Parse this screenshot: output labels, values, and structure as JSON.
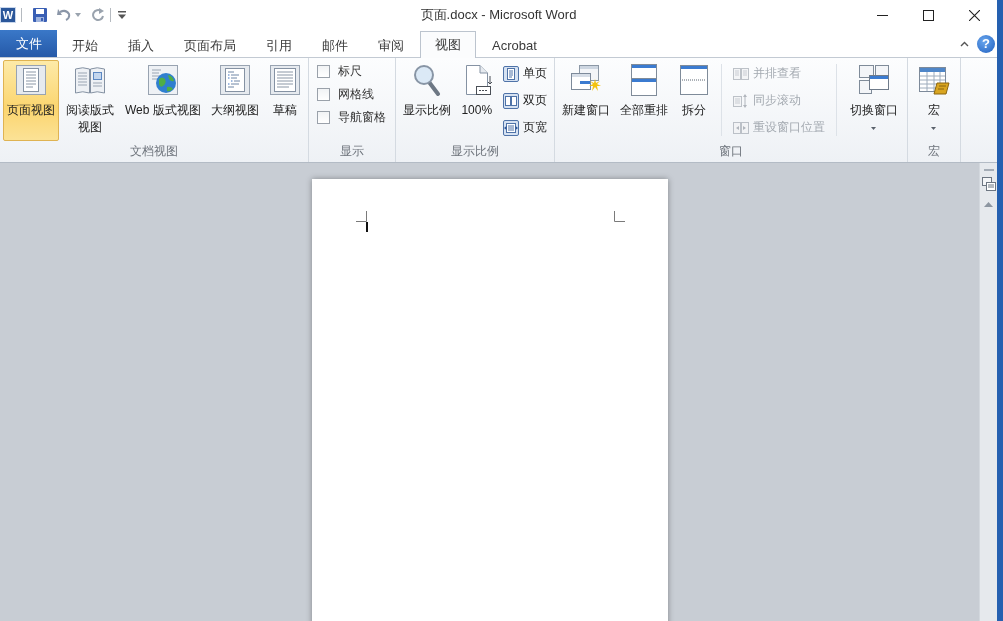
{
  "title_bar": {
    "app_icon": "W",
    "title": "页面.docx - Microsoft Word"
  },
  "tabs": [
    {
      "label": "文件",
      "kind": "file",
      "selected": false
    },
    {
      "label": "开始",
      "kind": "tab",
      "selected": false
    },
    {
      "label": "插入",
      "kind": "tab",
      "selected": false
    },
    {
      "label": "页面布局",
      "kind": "tab",
      "selected": false
    },
    {
      "label": "引用",
      "kind": "tab",
      "selected": false
    },
    {
      "label": "邮件",
      "kind": "tab",
      "selected": false
    },
    {
      "label": "审阅",
      "kind": "tab",
      "selected": false
    },
    {
      "label": "视图",
      "kind": "tab",
      "selected": true
    },
    {
      "label": "Acrobat",
      "kind": "tab",
      "selected": false
    }
  ],
  "help": {
    "label": "?"
  },
  "ribbon": [
    {
      "label": "文档视图",
      "items": [
        {
          "kind": "large",
          "label": "页面视图",
          "selected": true
        },
        {
          "kind": "large",
          "label": "阅读版式视图",
          "selected": false
        },
        {
          "kind": "large",
          "label": "Web 版式视图",
          "selected": false
        },
        {
          "kind": "large",
          "label": "大纲视图",
          "selected": false
        },
        {
          "kind": "large",
          "label": "草稿",
          "selected": false
        }
      ]
    },
    {
      "label": "显示",
      "items": [
        {
          "kind": "checkbox",
          "label": "标尺",
          "checked": false
        },
        {
          "kind": "checkbox",
          "label": "网格线",
          "checked": false
        },
        {
          "kind": "checkbox",
          "label": "导航窗格",
          "checked": false
        }
      ]
    },
    {
      "label": "显示比例",
      "items": [
        {
          "kind": "large",
          "label": "显示比例"
        },
        {
          "kind": "large",
          "label": "100%"
        },
        {
          "kind": "small",
          "label": "单页",
          "disabled": false
        },
        {
          "kind": "small",
          "label": "双页",
          "disabled": false
        },
        {
          "kind": "small",
          "label": "页宽",
          "disabled": false
        }
      ]
    },
    {
      "label": "窗口",
      "items": [
        {
          "kind": "large",
          "label": "新建窗口"
        },
        {
          "kind": "large",
          "label": "全部重排"
        },
        {
          "kind": "large",
          "label": "拆分"
        },
        {
          "kind": "small",
          "label": "并排查看",
          "disabled": true
        },
        {
          "kind": "small",
          "label": "同步滚动",
          "disabled": true
        },
        {
          "kind": "small",
          "label": "重设窗口位置",
          "disabled": true
        },
        {
          "kind": "dropdown",
          "label": "切换窗口"
        }
      ]
    },
    {
      "label": "宏",
      "items": [
        {
          "kind": "dropdown",
          "label": "宏"
        }
      ]
    }
  ]
}
